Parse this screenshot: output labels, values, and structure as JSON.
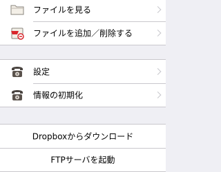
{
  "section_files": {
    "items": [
      {
        "label": "ファイルを見る",
        "icon": "folder-icon"
      },
      {
        "label": "ファイルを追加／削除する",
        "icon": "add-remove-files-icon"
      }
    ]
  },
  "section_settings": {
    "items": [
      {
        "label": "設定",
        "icon": "rotary-phone-icon"
      },
      {
        "label": "情報の初期化",
        "icon": "rotary-phone-icon"
      }
    ]
  },
  "section_actions": {
    "items": [
      {
        "label": "Dropboxからダウンロード"
      },
      {
        "label": "FTPサーバを起動"
      }
    ]
  },
  "colors": {
    "background": "#efeff4",
    "cell": "#ffffff",
    "separator": "#c8c7cc",
    "chevron": "#c7c7cc",
    "text": "#000000",
    "accent_red": "#d9262c",
    "icon_dark": "#4a4440"
  }
}
